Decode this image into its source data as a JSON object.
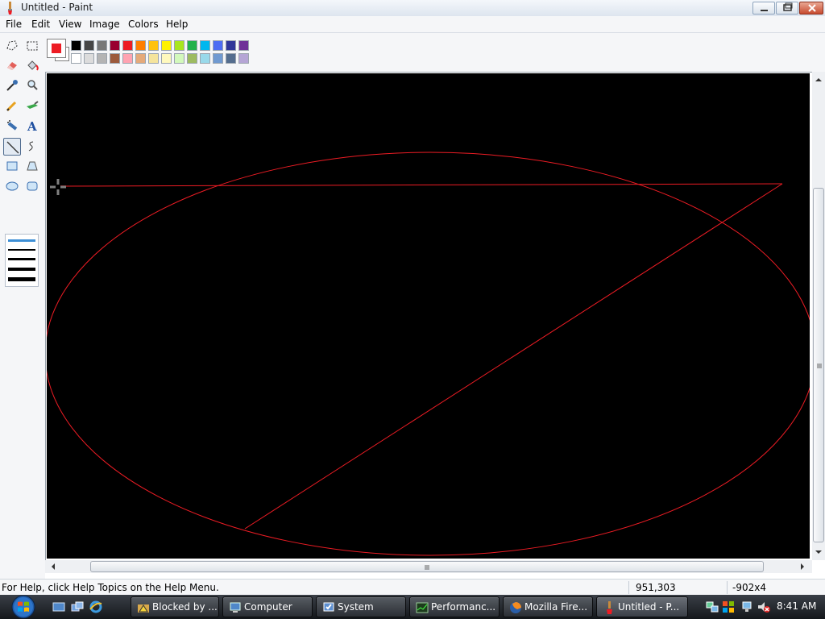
{
  "window": {
    "title": "Untitled - Paint"
  },
  "menu": {
    "items": [
      "File",
      "Edit",
      "View",
      "Image",
      "Colors",
      "Help"
    ]
  },
  "colors": {
    "foreground": "#ed1c24",
    "background": "#ffffff",
    "palette_row1": [
      "#000000",
      "#464646",
      "#787878",
      "#990030",
      "#ed1c24",
      "#ff7e00",
      "#ffc20e",
      "#fff200",
      "#a8e61d",
      "#22b14c",
      "#00b7ef",
      "#4d6df3",
      "#2f3699",
      "#6f3198"
    ],
    "palette_row2": [
      "#ffffff",
      "#dcdcdc",
      "#b4b4b4",
      "#9c5a3c",
      "#ffa3b1",
      "#e5aa7a",
      "#f5e49c",
      "#fff9bd",
      "#d3f9bc",
      "#9dbb61",
      "#99d9ea",
      "#709ad1",
      "#546d8e",
      "#b5a5d5"
    ]
  },
  "tools": [
    {
      "name": "free-form-select-icon"
    },
    {
      "name": "select-icon"
    },
    {
      "name": "eraser-icon"
    },
    {
      "name": "fill-bucket-icon"
    },
    {
      "name": "color-picker-icon"
    },
    {
      "name": "magnifier-icon"
    },
    {
      "name": "pencil-icon"
    },
    {
      "name": "brush-icon"
    },
    {
      "name": "airbrush-icon"
    },
    {
      "name": "text-icon"
    },
    {
      "name": "line-icon",
      "active": true
    },
    {
      "name": "curve-icon"
    },
    {
      "name": "rectangle-icon"
    },
    {
      "name": "polygon-icon"
    },
    {
      "name": "ellipse-icon"
    },
    {
      "name": "rounded-rectangle-icon"
    }
  ],
  "canvas": {
    "background": "#000000",
    "stroke_color": "#ed1c24"
  },
  "status": {
    "help_text": "For Help, click Help Topics on the Help Menu.",
    "cursor_position": "951,303",
    "selection_size": "-902x4"
  },
  "taskbar": {
    "buttons": [
      {
        "label": "Blocked by ...",
        "icon": "warning-folder-icon"
      },
      {
        "label": "Computer",
        "icon": "computer-icon"
      },
      {
        "label": "System",
        "icon": "system-icon"
      },
      {
        "label": "Performanc...",
        "icon": "performance-icon"
      },
      {
        "label": "Mozilla Fire...",
        "icon": "firefox-icon"
      },
      {
        "label": "Untitled - P...",
        "icon": "paint-icon",
        "active": true
      }
    ],
    "clock": "8:41 AM"
  }
}
